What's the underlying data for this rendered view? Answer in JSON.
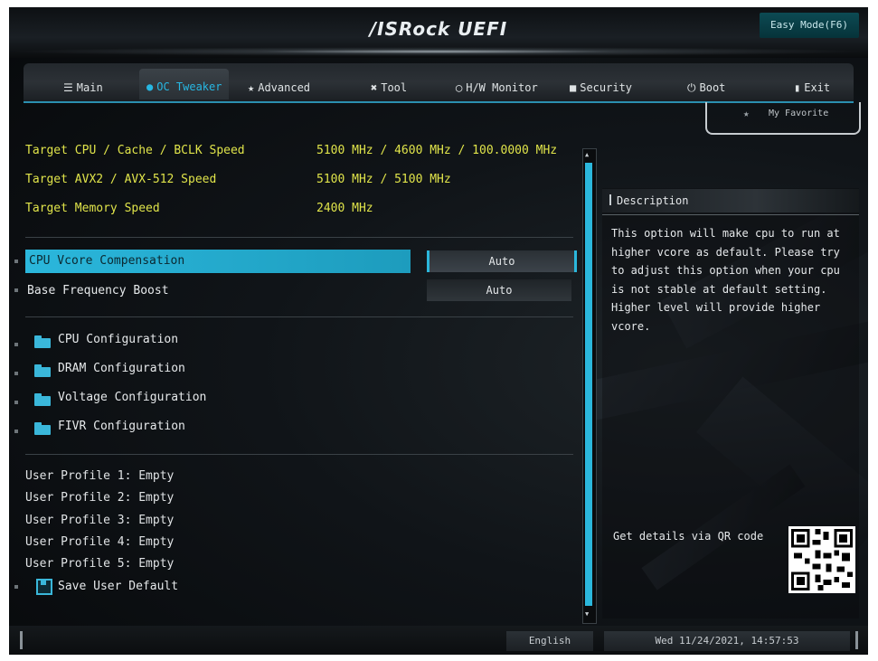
{
  "header": {
    "brand": "/ISRock UEFI",
    "easy_mode_label": "Easy Mode(F6)"
  },
  "tabs": [
    {
      "label": "Main",
      "icon": "list-icon",
      "active": false
    },
    {
      "label": "OC Tweaker",
      "icon": "flame-icon",
      "active": true
    },
    {
      "label": "Advanced",
      "icon": "star-icon",
      "active": false
    },
    {
      "label": "Tool",
      "icon": "wrench-icon",
      "active": false
    },
    {
      "label": "H/W Monitor",
      "icon": "monitor-icon",
      "active": false
    },
    {
      "label": "Security",
      "icon": "shield-icon",
      "active": false
    },
    {
      "label": "Boot",
      "icon": "power-icon",
      "active": false
    },
    {
      "label": "Exit",
      "icon": "exit-icon",
      "active": false
    }
  ],
  "favorite": {
    "label": "My Favorite"
  },
  "info_rows": [
    {
      "label": "Target CPU / Cache / BCLK Speed",
      "value": "5100 MHz / 4600 MHz / 100.0000 MHz"
    },
    {
      "label": "Target AVX2 / AVX-512 Speed",
      "value": "5100 MHz / 5100 MHz"
    },
    {
      "label": "Target Memory Speed",
      "value": "2400 MHz"
    }
  ],
  "settings": [
    {
      "label": "CPU Vcore Compensation",
      "value": "Auto",
      "selected": true
    },
    {
      "label": "Base Frequency Boost",
      "value": "Auto",
      "selected": false
    }
  ],
  "submenus": [
    {
      "label": "CPU Configuration"
    },
    {
      "label": "DRAM Configuration"
    },
    {
      "label": "Voltage Configuration"
    },
    {
      "label": "FIVR Configuration"
    }
  ],
  "profiles": [
    "User Profile 1: Empty",
    "User Profile 2: Empty",
    "User Profile 3: Empty",
    "User Profile 4: Empty",
    "User Profile 5: Empty"
  ],
  "save_default": "Save User Default",
  "description": {
    "title": "Description",
    "text": "This option will make cpu to run at higher vcore as default. Please try to adjust this option when your cpu is not stable at default setting. Higher level will provide higher vcore.",
    "qr_label": "Get details via QR code"
  },
  "footer": {
    "language": "English",
    "datetime": "Wed 11/24/2021, 14:57:53"
  },
  "colors": {
    "accent": "#2bb7dc",
    "info_text": "#e0e44a"
  }
}
